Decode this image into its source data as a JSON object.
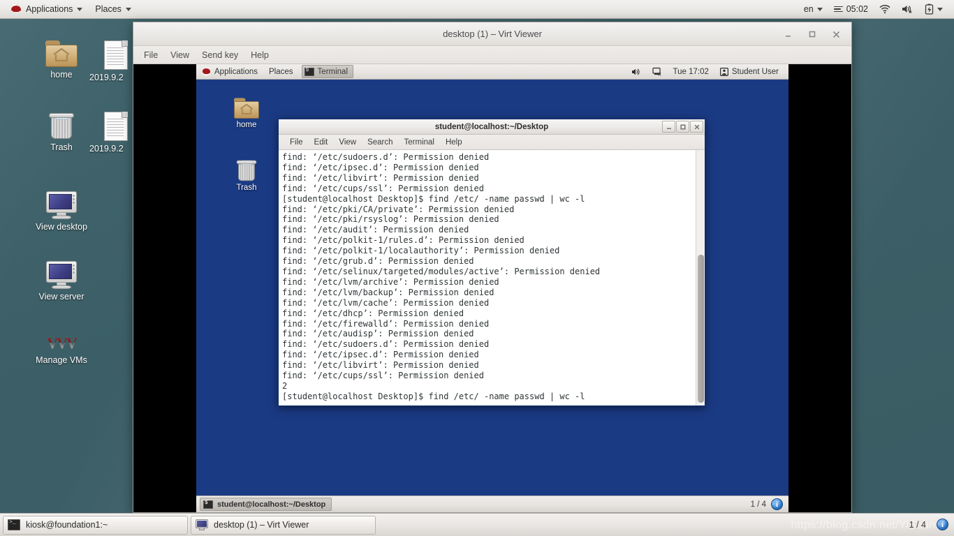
{
  "outer_panel": {
    "logo_icon": "redhat-logo-icon",
    "menus": [
      {
        "label": "Applications",
        "caret": true
      },
      {
        "label": "Places",
        "caret": true
      }
    ],
    "right": {
      "input_source": "en",
      "clock": "05:02",
      "icons": [
        "hamburger-icon",
        "wifi-icon",
        "volume-muted-icon",
        "battery-icon",
        "chevron-down-icon"
      ]
    }
  },
  "outer_desktop": {
    "background_color": "#3d6068",
    "icons": [
      {
        "name": "home",
        "label": "home",
        "icon": "home-folder-icon"
      },
      {
        "name": "doc1",
        "label": "2019.9.2",
        "icon": "document-icon"
      },
      {
        "name": "trash",
        "label": "Trash",
        "icon": "trash-icon"
      },
      {
        "name": "doc2",
        "label": "2019.9.2",
        "icon": "document-icon"
      },
      {
        "name": "view-desktop",
        "label": "View desktop",
        "icon": "monitor-icon"
      },
      {
        "name": "view-server",
        "label": "View server",
        "icon": "monitor-icon"
      },
      {
        "name": "manage-vms",
        "label": "Manage VMs",
        "icon": "vm-logo-icon"
      }
    ]
  },
  "virt_viewer": {
    "title": "desktop (1) – Virt Viewer",
    "window_controls": {
      "minimize": "_",
      "maximize": "□",
      "close": "✕"
    },
    "menu": [
      "File",
      "View",
      "Send key",
      "Help"
    ]
  },
  "vm": {
    "background_color": "#1a3a84",
    "panel": {
      "logo_icon": "redhat-logo-icon",
      "menus": [
        "Applications",
        "Places"
      ],
      "window_button": {
        "label": "Terminal",
        "icon": "terminal-icon"
      },
      "right": {
        "icons": [
          "volume-icon",
          "network-disconnected-icon"
        ],
        "clock": "Tue 17:02",
        "user_icon": "user-icon",
        "user": "Student User"
      }
    },
    "desktop_icons": [
      {
        "name": "home",
        "label": "home",
        "icon": "home-folder-icon"
      },
      {
        "name": "trash",
        "label": "Trash",
        "icon": "trash-icon"
      }
    ],
    "taskbar": {
      "window_button": {
        "label": "student@localhost:~/Desktop",
        "icon": "terminal-icon"
      },
      "workspace": "1 / 4",
      "info_icon": "info-icon",
      "info_label": "i"
    }
  },
  "terminal": {
    "title": "student@localhost:~/Desktop",
    "window_controls": {
      "minimize": "_",
      "maximize": "□",
      "close": "✕"
    },
    "menu": [
      "File",
      "Edit",
      "View",
      "Search",
      "Terminal",
      "Help"
    ],
    "scrollbar": {
      "thumb_top_pct": 41,
      "thumb_height_pct": 58
    },
    "lines": [
      "find: ‘/etc/sudoers.d’: Permission denied",
      "find: ‘/etc/ipsec.d’: Permission denied",
      "find: ‘/etc/libvirt’: Permission denied",
      "find: ‘/etc/cups/ssl’: Permission denied",
      "[student@localhost Desktop]$ find /etc/ -name passwd | wc -l",
      "find: ‘/etc/pki/CA/private’: Permission denied",
      "find: ‘/etc/pki/rsyslog’: Permission denied",
      "find: ‘/etc/audit’: Permission denied",
      "find: ‘/etc/polkit-1/rules.d’: Permission denied",
      "find: ‘/etc/polkit-1/localauthority’: Permission denied",
      "find: ‘/etc/grub.d’: Permission denied",
      "find: ‘/etc/selinux/targeted/modules/active’: Permission denied",
      "find: ‘/etc/lvm/archive’: Permission denied",
      "find: ‘/etc/lvm/backup’: Permission denied",
      "find: ‘/etc/lvm/cache’: Permission denied",
      "find: ‘/etc/dhcp’: Permission denied",
      "find: ‘/etc/firewalld’: Permission denied",
      "find: ‘/etc/audisp’: Permission denied",
      "find: ‘/etc/sudoers.d’: Permission denied",
      "find: ‘/etc/ipsec.d’: Permission denied",
      "find: ‘/etc/libvirt’: Permission denied",
      "find: ‘/etc/cups/ssl’: Permission denied",
      "2",
      "[student@localhost Desktop]$ find /etc/ -name passwd | wc -l"
    ]
  },
  "outer_taskbar": {
    "buttons": [
      {
        "label": "kiosk@foundation1:~",
        "icon": "terminal-icon"
      },
      {
        "label": "desktop (1) – Virt Viewer",
        "icon": "monitor-icon"
      }
    ],
    "workspace": "1 / 4",
    "info_label": "i",
    "watermark": "https://blog.csdn.net/YiSean96"
  }
}
